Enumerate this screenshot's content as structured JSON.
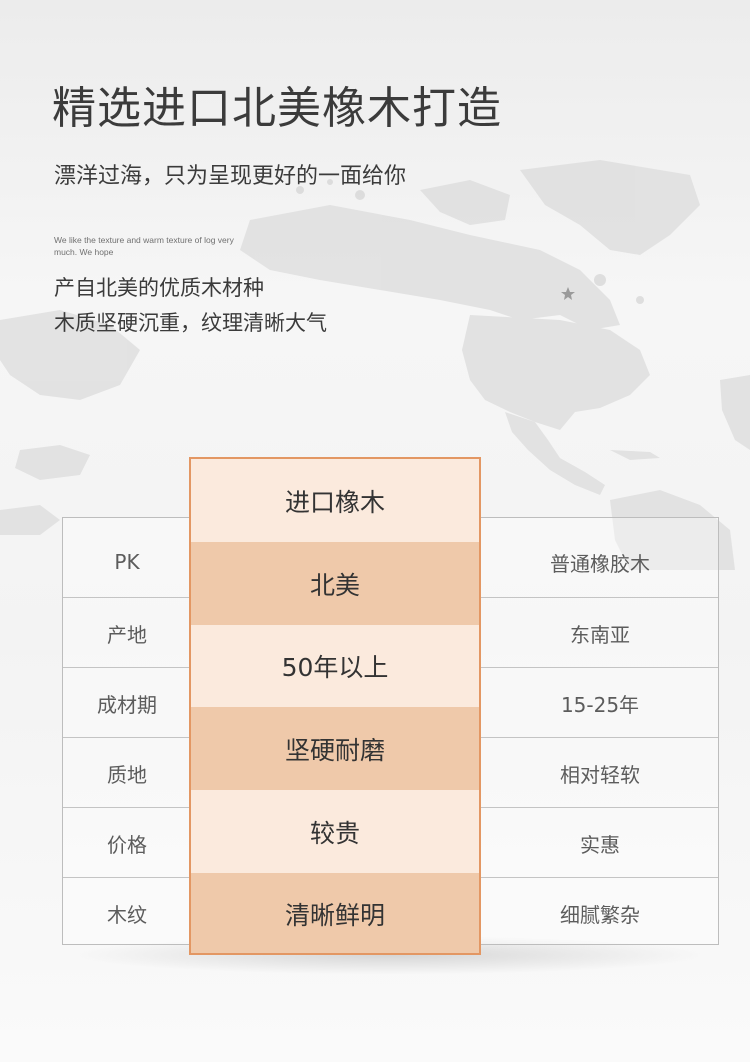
{
  "header": {
    "title": "精选进口北美橡木打造",
    "subtitle": "漂洋过海，只为呈现更好的一面给你",
    "english_note": "We like the texture and warm texture of log very much. We hope",
    "desc_line1": "产自北美的优质木材种",
    "desc_line2": "木质坚硬沉重，纹理清晰大气"
  },
  "comparison": {
    "left_labels": [
      "PK",
      "产地",
      "成材期",
      "质地",
      "价格",
      "木纹"
    ],
    "middle": [
      "进口橡木",
      "北美",
      "50年以上",
      "坚硬耐磨",
      "较贵",
      "清晰鲜明"
    ],
    "right": [
      "普通橡胶木",
      "东南亚",
      "15-25年",
      "相对轻软",
      "实惠",
      "细腻繁杂"
    ]
  },
  "colors": {
    "accent_border": "#e39763",
    "cell_light": "#fbeadd",
    "cell_dark": "#efc9aa"
  },
  "icons": [
    "world-map",
    "star-icon"
  ]
}
